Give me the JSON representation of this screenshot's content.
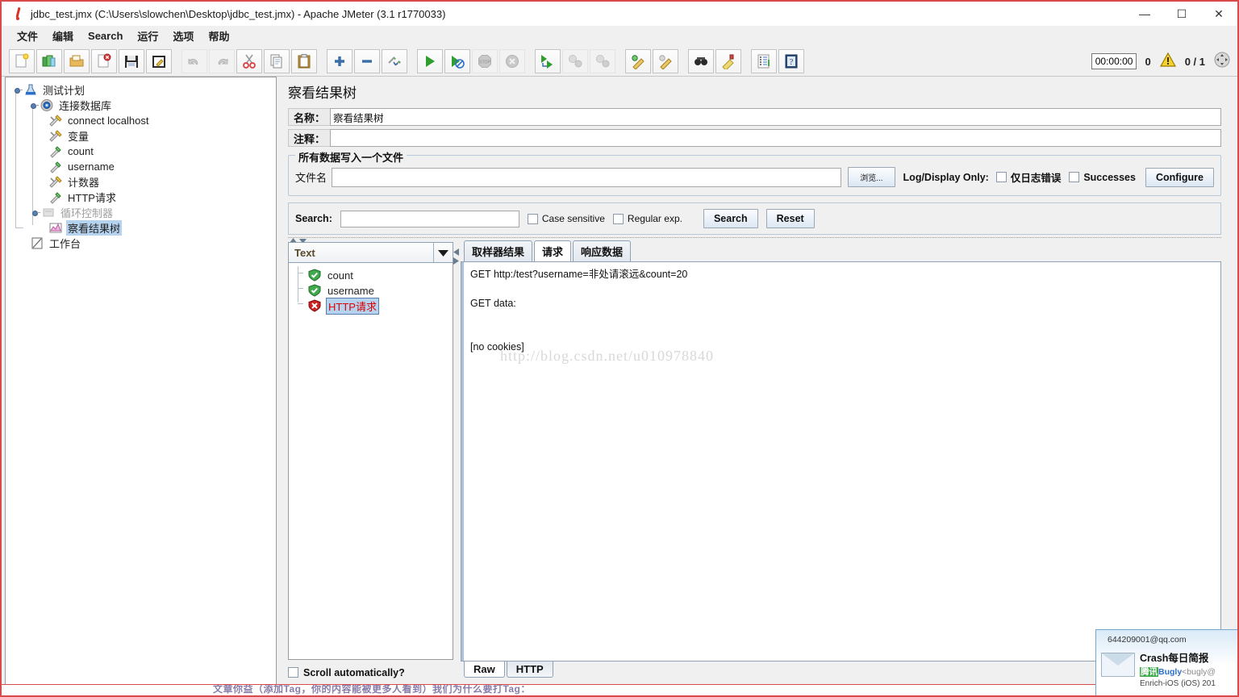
{
  "window": {
    "title": "jdbc_test.jmx (C:\\Users\\slowchen\\Desktop\\jdbc_test.jmx) - Apache JMeter (3.1 r1770033)",
    "minimize": "—",
    "maximize": "☐",
    "close": "✕"
  },
  "menu": {
    "items": [
      {
        "label": "文件"
      },
      {
        "label": "编辑"
      },
      {
        "label": "Search"
      },
      {
        "label": "运行"
      },
      {
        "label": "选项"
      },
      {
        "label": "帮助"
      }
    ]
  },
  "toolbar": {
    "buttons": [
      {
        "name": "new-icon",
        "disabled": false
      },
      {
        "name": "templates-icon",
        "disabled": false
      },
      {
        "name": "open-icon",
        "disabled": false
      },
      {
        "name": "close-icon",
        "disabled": false
      },
      {
        "name": "save-icon",
        "disabled": false
      },
      {
        "name": "save-as-icon",
        "disabled": false
      },
      {
        "name": "undo-icon",
        "disabled": true
      },
      {
        "name": "redo-icon",
        "disabled": true
      },
      {
        "name": "cut-icon",
        "disabled": false
      },
      {
        "name": "copy-icon",
        "disabled": false
      },
      {
        "name": "paste-icon",
        "disabled": false
      },
      {
        "name": "expand-all-icon",
        "disabled": false
      },
      {
        "name": "collapse-all-icon",
        "disabled": false
      },
      {
        "name": "toggle-icon",
        "disabled": false
      },
      {
        "name": "start-icon",
        "disabled": false
      },
      {
        "name": "start-no-pauses-icon",
        "disabled": false
      },
      {
        "name": "stop-icon",
        "disabled": true
      },
      {
        "name": "shutdown-icon",
        "disabled": true
      },
      {
        "name": "start-remote-icon",
        "disabled": false
      },
      {
        "name": "stop-remote-icon",
        "disabled": true
      },
      {
        "name": "shutdown-remote-icon",
        "disabled": true
      },
      {
        "name": "clear-icon",
        "disabled": false
      },
      {
        "name": "clear-all-icon",
        "disabled": false
      },
      {
        "name": "search-icon",
        "disabled": false
      },
      {
        "name": "reset-search-icon",
        "disabled": false
      },
      {
        "name": "function-helper-icon",
        "disabled": false
      },
      {
        "name": "help-icon",
        "disabled": false
      }
    ]
  },
  "status": {
    "timer": "00:00:00",
    "warnings": "0",
    "threads": "0 / 1"
  },
  "tree": {
    "nodes": [
      {
        "label": "测试计划",
        "icon": "test-plan-icon",
        "depth": 0,
        "expander": true,
        "selected": false,
        "disabled": false
      },
      {
        "label": "连接数据库",
        "icon": "thread-group-icon",
        "depth": 1,
        "expander": true,
        "selected": false,
        "disabled": false
      },
      {
        "label": "connect localhost",
        "icon": "config-element-icon",
        "depth": 2,
        "expander": false,
        "selected": false,
        "disabled": false
      },
      {
        "label": "变量",
        "icon": "config-element-icon",
        "depth": 2,
        "expander": false,
        "selected": false,
        "disabled": false
      },
      {
        "label": "count",
        "icon": "pre-processor-icon",
        "depth": 2,
        "expander": false,
        "selected": false,
        "disabled": false
      },
      {
        "label": "username",
        "icon": "pre-processor-icon",
        "depth": 2,
        "expander": false,
        "selected": false,
        "disabled": false
      },
      {
        "label": "计数器",
        "icon": "config-element-icon",
        "depth": 2,
        "expander": false,
        "selected": false,
        "disabled": false
      },
      {
        "label": "HTTP请求",
        "icon": "pre-processor-icon",
        "depth": 2,
        "expander": false,
        "selected": false,
        "disabled": false
      },
      {
        "label": "循环控制器",
        "icon": "controller-icon",
        "depth": 2,
        "expander": true,
        "selected": false,
        "disabled": true
      },
      {
        "label": "察看结果树",
        "icon": "view-results-tree-icon",
        "depth": 2,
        "expander": false,
        "selected": true,
        "disabled": false
      },
      {
        "label": "工作台",
        "icon": "workbench-icon",
        "depth": 0,
        "expander": false,
        "selected": false,
        "disabled": false
      }
    ]
  },
  "panel": {
    "title": "察看结果树",
    "name_label": "名称：",
    "name_value": "察看结果树",
    "comment_label": "注释：",
    "comment_value": "",
    "file_group_title": "所有数据写入一个文件",
    "filename_label": "文件名",
    "filename_value": "",
    "browse_label": "浏览...",
    "log_display_only_label": "Log/Display Only:",
    "errors_only_label": "仅日志错误",
    "errors_only_checked": false,
    "successes_label": "Successes",
    "successes_checked": false,
    "configure_label": "Configure"
  },
  "search": {
    "label": "Search:",
    "value": "",
    "case_sensitive_label": "Case sensitive",
    "case_sensitive_checked": false,
    "regex_label": "Regular exp.",
    "regex_checked": false,
    "search_button": "Search",
    "reset_button": "Reset"
  },
  "results": {
    "renderer_selected": "Text",
    "items": [
      {
        "label": "count",
        "status": "success"
      },
      {
        "label": "username",
        "status": "success"
      },
      {
        "label": "HTTP请求",
        "status": "error"
      }
    ],
    "scroll_auto_label": "Scroll automatically?",
    "scroll_auto_checked": false,
    "tabs": [
      {
        "label": "取样器结果",
        "active": false
      },
      {
        "label": "请求",
        "active": true
      },
      {
        "label": "响应数据",
        "active": false
      }
    ],
    "content": "GET http:/test?username=非处请滚远&count=20\n\nGET data:\n\n\n[no cookies]",
    "watermark": "http://blog.csdn.net/u010978840",
    "bottom_tabs": [
      {
        "label": "Raw",
        "active": true
      },
      {
        "label": "HTTP",
        "active": false
      }
    ]
  },
  "notification": {
    "account": "644209001@qq.com",
    "title": "Crash每日简报",
    "brand": "腾讯",
    "brand2": "Bugly",
    "address": "<bugly@",
    "footer": "Enrich-iOS (iOS) 201"
  },
  "bottom_strip": {
    "text": "文章你益（添加Tag，你的内容能被更多人看到）我们为什么要打Tag："
  },
  "colors": {
    "accent": "#d94a4a",
    "selection": "#b5d2ee",
    "error": "#cc0000",
    "success": "#3fa94c"
  }
}
